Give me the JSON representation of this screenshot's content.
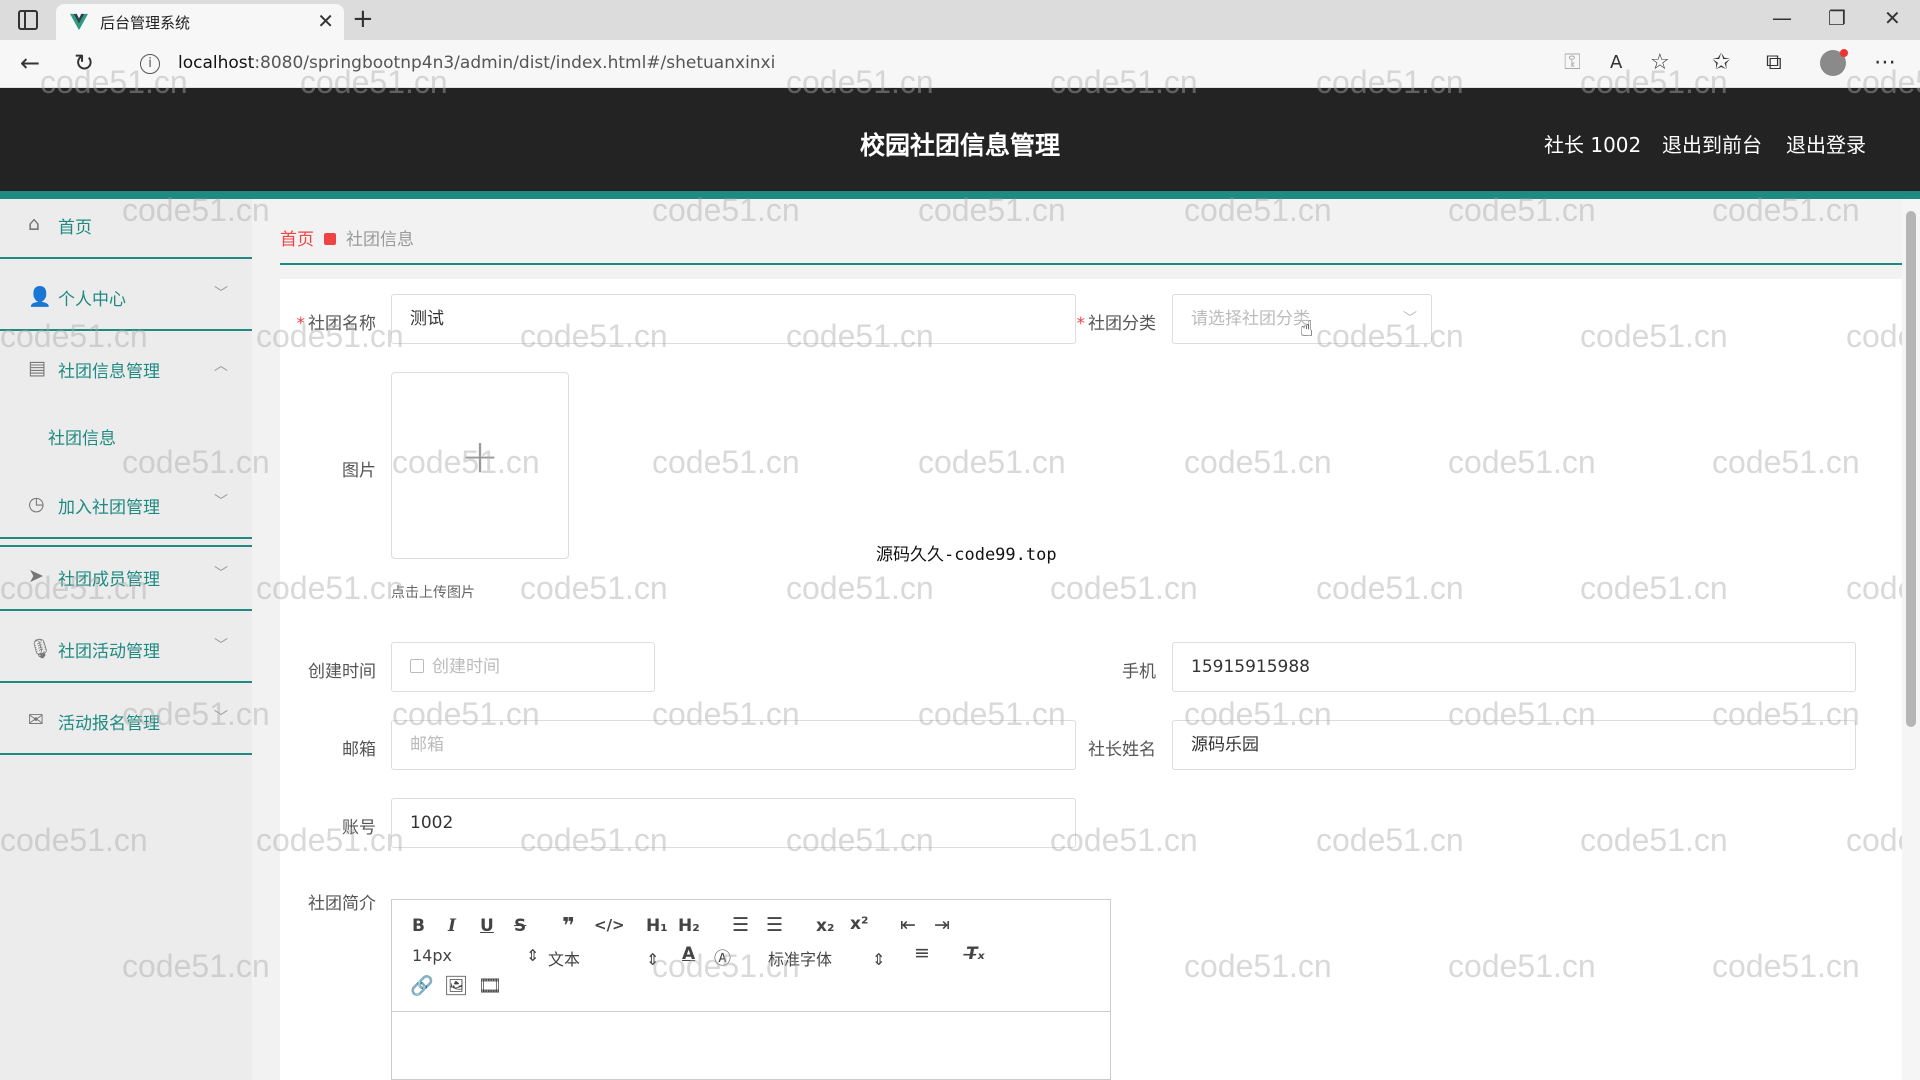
{
  "browser": {
    "tab_title": "后台管理系统",
    "url_host": "localhost",
    "url_rest": ":8080/springbootnp4n3/admin/dist/index.html#/shetuanxinxi"
  },
  "header": {
    "title": "校园社团信息管理",
    "user": "社长 1002",
    "to_front": "退出到前台",
    "logout": "退出登录"
  },
  "sidebar": {
    "items": [
      {
        "label": "首页",
        "icon": "home-icon"
      },
      {
        "label": "个人中心",
        "icon": "user-icon"
      },
      {
        "label": "社团信息管理",
        "icon": "clipboard-icon"
      },
      {
        "label": "加入社团管理",
        "icon": "clock-icon"
      },
      {
        "label": "社团成员管理",
        "icon": "send-icon"
      },
      {
        "label": "社团活动管理",
        "icon": "mic-icon"
      },
      {
        "label": "活动报名管理",
        "icon": "mail-icon"
      }
    ],
    "sub_item": "社团信息"
  },
  "breadcrumb": {
    "home": "首页",
    "current": "社团信息"
  },
  "form": {
    "name_label": "社团名称",
    "name_value": "测试",
    "category_label": "社团分类",
    "category_placeholder": "请选择社团分类",
    "image_label": "图片",
    "upload_hint": "点击上传图片",
    "created_label": "创建时间",
    "created_placeholder": "创建时间",
    "phone_label": "手机",
    "phone_value": "15915915988",
    "email_label": "邮箱",
    "email_placeholder": "邮箱",
    "leader_label": "社长姓名",
    "leader_value": "源码乐园",
    "account_label": "账号",
    "account_value": "1002",
    "intro_label": "社团简介"
  },
  "editor": {
    "size_select": "14px",
    "text_select": "文本",
    "font_select": "标准字体"
  },
  "center_note": "源码久久-code99.top",
  "watermark": "code51.cn"
}
